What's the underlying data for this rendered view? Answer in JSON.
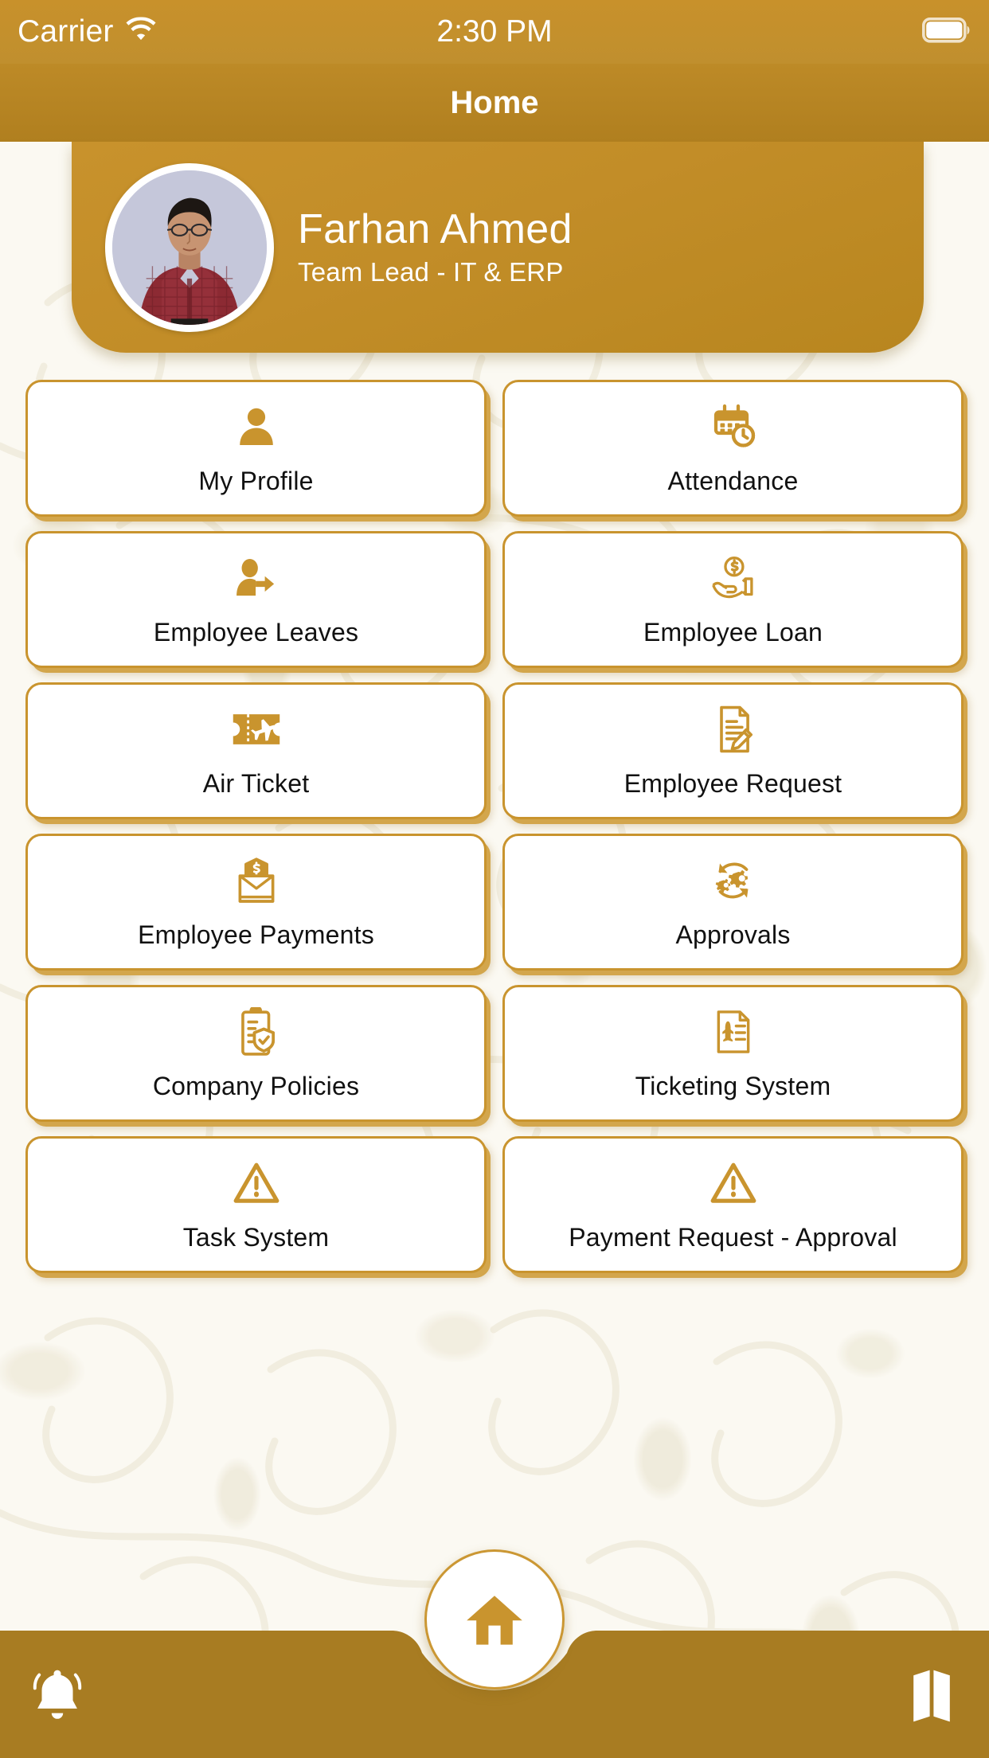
{
  "status_bar": {
    "carrier": "Carrier",
    "time": "2:30 PM",
    "wifi_icon": "wifi-icon",
    "battery_icon": "battery-full-icon"
  },
  "nav_bar": {
    "title": "Home"
  },
  "profile": {
    "name": "Farhan Ahmed",
    "role": "Team Lead - IT & ERP",
    "avatar_icon": "user-photo-avatar"
  },
  "menu": {
    "tiles": [
      {
        "label": "My Profile",
        "icon": "user-icon"
      },
      {
        "label": "Attendance",
        "icon": "calendar-clock-icon"
      },
      {
        "label": "Employee Leaves",
        "icon": "user-exit-arrow-icon"
      },
      {
        "label": "Employee Loan",
        "icon": "hand-money-icon"
      },
      {
        "label": "Air Ticket",
        "icon": "ticket-plane-icon"
      },
      {
        "label": "Employee Request",
        "icon": "document-pencil-icon"
      },
      {
        "label": "Employee Payments",
        "icon": "envelope-money-icon"
      },
      {
        "label": "Approvals",
        "icon": "gears-refresh-icon"
      },
      {
        "label": "Company Policies",
        "icon": "clipboard-shield-icon"
      },
      {
        "label": "Ticketing System",
        "icon": "document-plane-icon"
      },
      {
        "label": "Task System",
        "icon": "warning-triangle-icon"
      },
      {
        "label": "Payment Request - Approval",
        "icon": "warning-triangle-icon"
      }
    ]
  },
  "bottom_bar": {
    "left_icon": "bell-icon",
    "center_icon": "home-icon",
    "right_icon": "map-icon"
  },
  "colors": {
    "gold": "#c9942e",
    "gold_dark": "#b07f1f",
    "tile_bg": "#ffffff",
    "page_bg": "#fbf9f2",
    "text": "#111111",
    "on_gold_text": "#ffffff"
  }
}
